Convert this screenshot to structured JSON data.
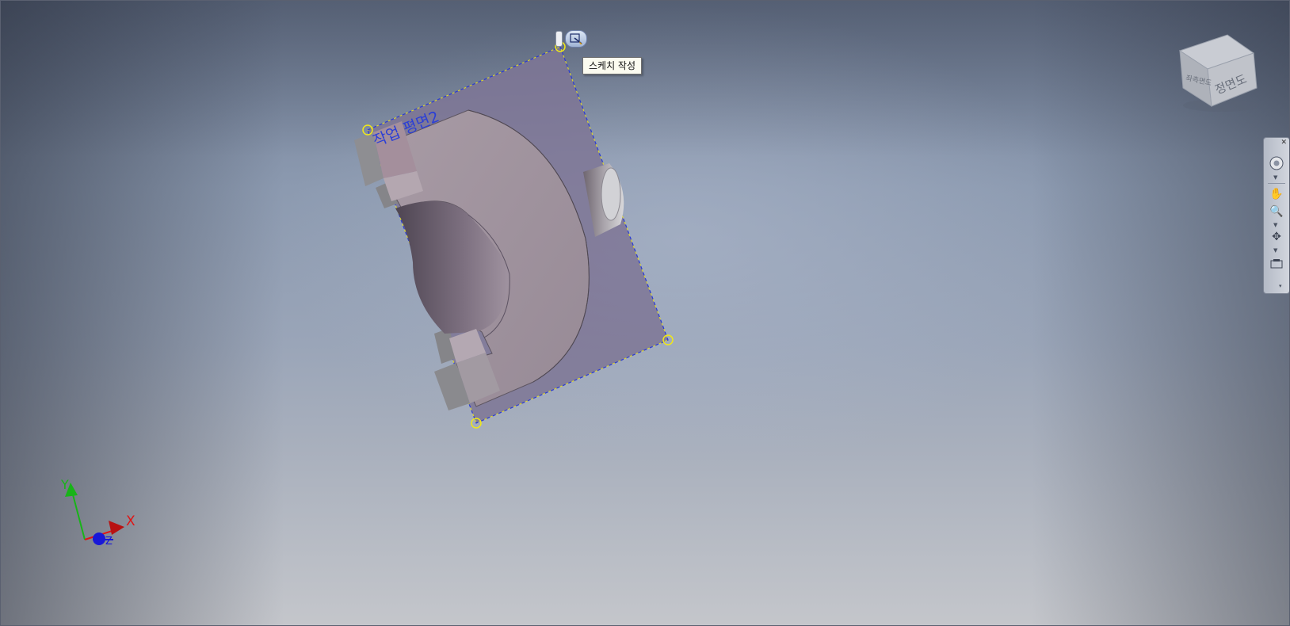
{
  "viewport": {
    "background": "#8c9ab0"
  },
  "work_plane": {
    "label": "작업 평면2",
    "color": "#2b3fd6"
  },
  "tooltip": {
    "text": "스케치 작성"
  },
  "sketch_button": {
    "icon": "create-sketch-icon"
  },
  "viewcube": {
    "front_label": "정면도",
    "side_label": "좌측면도"
  },
  "navigation_bar": {
    "items": [
      "full-navigation-wheel-icon",
      "pan-icon",
      "zoom-icon",
      "orbit-icon",
      "look-at-icon"
    ]
  },
  "axes": {
    "x_label": "X",
    "y_label": "Y",
    "z_label": "Z",
    "x_color": "#e01414",
    "y_color": "#18b418",
    "z_color": "#1818d8"
  }
}
